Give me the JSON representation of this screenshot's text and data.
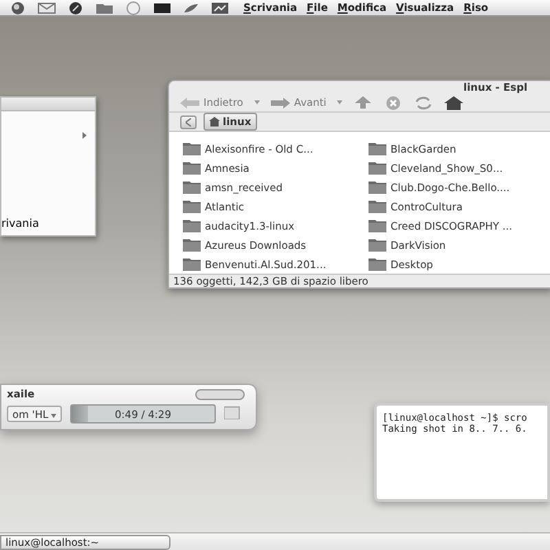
{
  "top_panel": {
    "menus": [
      {
        "label": "Scrivania"
      },
      {
        "label": "File"
      },
      {
        "label": "Modifica"
      },
      {
        "label": "Visualizza"
      },
      {
        "label": "Riso"
      }
    ]
  },
  "side_menu": {
    "label": "rivania"
  },
  "file_manager": {
    "title": "linux - Espl",
    "toolbar": [
      {
        "label": "Indietro",
        "kind": "back"
      },
      {
        "label": "Avanti",
        "kind": "forward"
      }
    ],
    "location": "linux",
    "items": [
      {
        "name": "Alexisonfire - Old C..."
      },
      {
        "name": "Amnesia"
      },
      {
        "name": "amsn_received"
      },
      {
        "name": "Atlantic"
      },
      {
        "name": "audacity1.3-linux"
      },
      {
        "name": "Azureus Downloads"
      },
      {
        "name": "Benvenuti.Al.Sud.201..."
      },
      {
        "name": "BlackGarden"
      },
      {
        "name": "Cleveland_Show_S0..."
      },
      {
        "name": "Club.Dogo-Che.Bello...."
      },
      {
        "name": "ControCultura"
      },
      {
        "name": "Creed DISCOGRAPHY ..."
      },
      {
        "name": "DarkVision"
      },
      {
        "name": "Desktop"
      }
    ],
    "status": "136 oggetti, 142,3 GB di spazio libero"
  },
  "player": {
    "title": "xaile",
    "selector": "om 'HL",
    "progress": {
      "level": 0.12,
      "time": "0:49 / 4:29"
    }
  },
  "terminal": {
    "lines": [
      "[linux@localhost ~]$ scro",
      "Taking shot in 8.. 7.. 6."
    ]
  },
  "taskbar": {
    "tasks": [
      {
        "label": "linux@localhost:~"
      }
    ]
  }
}
